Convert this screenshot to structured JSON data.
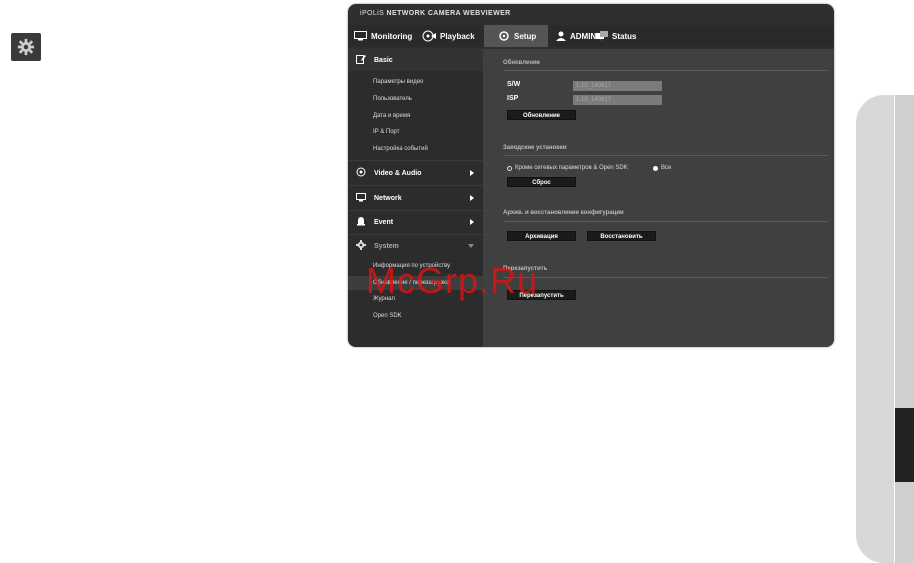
{
  "window": {
    "title_brand": "iPOLiS",
    "title_text": "NETWORK CAMERA WEBVIEWER"
  },
  "nav": {
    "monitoring": "Monitoring",
    "playback": "Playback",
    "setup": "Setup",
    "admin": "ADMIN",
    "status": "Status"
  },
  "sidebar": {
    "basic": "Basic",
    "basic_items": [
      "Параметры видео",
      "Пользователь",
      "Дата и время",
      "IP & Порт",
      "Настройка событий"
    ],
    "video_audio": "Video & Audio",
    "network": "Network",
    "event": "Event",
    "system": "System",
    "system_items": [
      "Информация по устройству",
      "Обновление / перезагрузка",
      "Журнал",
      "Open SDK"
    ]
  },
  "content": {
    "update_title": "Обновление",
    "sw_label": "S/W",
    "sw_value": "1.10_140617",
    "isp_label": "ISP",
    "isp_value": "1.10_140617",
    "update_button": "Обновление",
    "factory_title": "Заводские установки",
    "factory_option_1": "Кроме сетевых параметров & Open SDK",
    "factory_option_2": "Все",
    "reset_button": "Сброс",
    "backup_title": "Архив. и восстановление конфигурации",
    "backup_button": "Архивация",
    "restore_button": "Восстановить",
    "restart_title": "Перезапустить",
    "restart_button": "Перезапустить"
  },
  "watermark": "McGrp.Ru"
}
